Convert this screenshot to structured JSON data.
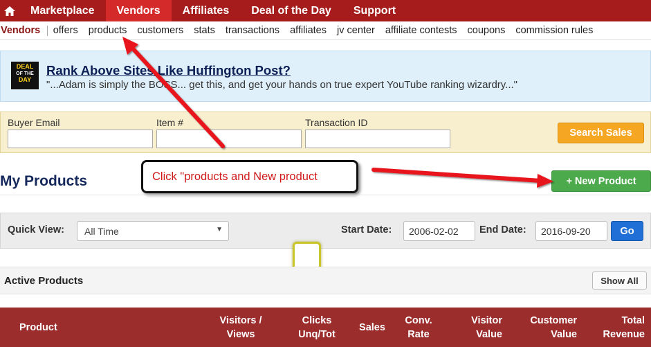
{
  "topnav": {
    "items": [
      {
        "label": "Marketplace",
        "active": false
      },
      {
        "label": "Vendors",
        "active": true
      },
      {
        "label": "Affiliates",
        "active": false
      },
      {
        "label": "Deal of the Day",
        "active": false
      },
      {
        "label": "Support",
        "active": false
      }
    ]
  },
  "subnav": {
    "lead": "Vendors",
    "items": [
      "offers",
      "products",
      "customers",
      "stats",
      "transactions",
      "affiliates",
      "jv center",
      "affiliate contests",
      "coupons",
      "commission rules"
    ]
  },
  "banner": {
    "logo_lines": [
      "DEAL",
      "OF THE",
      "DAY"
    ],
    "title": "Rank Above Sites Like Huffington Post?",
    "quote": "\"...Adam is simply the BOSS... get this, and get your hands on true expert YouTube ranking wizardry...\""
  },
  "search": {
    "buyer_email_label": "Buyer Email",
    "buyer_email_value": "",
    "item_label": "Item #",
    "item_value": "",
    "transaction_label": "Transaction ID",
    "transaction_value": "",
    "button_label": "Search Sales"
  },
  "products": {
    "title": "My Products",
    "new_button_label": "+ New Product"
  },
  "annotation": {
    "callout_text": "Click \"products and New product"
  },
  "quick_view": {
    "label": "Quick View:",
    "selected": "All Time",
    "start_label": "Start Date:",
    "start_value": "2006-02-02",
    "end_label": "End Date:",
    "end_value": "2016-09-20",
    "go_label": "Go"
  },
  "active_products": {
    "title": "Active Products",
    "show_all_label": "Show All"
  },
  "table": {
    "headers": [
      {
        "line1": "Product",
        "line2": ""
      },
      {
        "line1": "Visitors /",
        "line2": "Views"
      },
      {
        "line1": "Clicks",
        "line2": "Unq/Tot"
      },
      {
        "line1": "Sales",
        "line2": ""
      },
      {
        "line1": "Conv.",
        "line2": "Rate"
      },
      {
        "line1": "Visitor",
        "line2": "Value"
      },
      {
        "line1": "Customer",
        "line2": "Value"
      },
      {
        "line1": "Total",
        "line2": "Revenue"
      }
    ]
  },
  "colors": {
    "topnav_bg": "#a61c1c",
    "topnav_active": "#d42a2a",
    "banner_bg": "#dff0fb",
    "search_bg": "#f8efcf",
    "search_button": "#f5a623",
    "new_button": "#4caa4c",
    "go_button": "#1f6fd6",
    "table_header": "#9c2d2d",
    "annotation_arrow": "#e8141b"
  }
}
